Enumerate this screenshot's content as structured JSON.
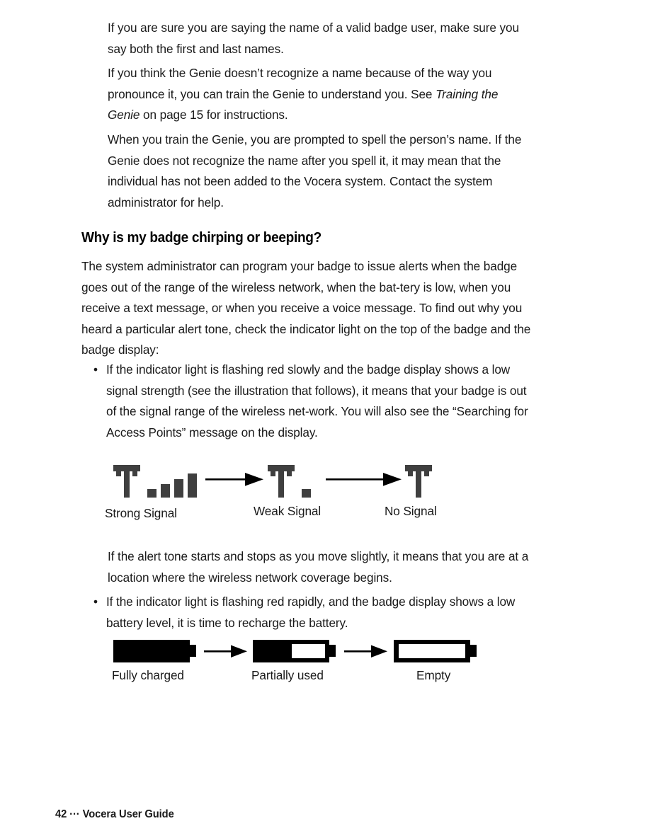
{
  "document": {
    "page_number": "42",
    "footer_separator": "···",
    "footer_title": "Vocera User Guide",
    "footer_full": "42 ··· Vocera User Guide"
  },
  "body": {
    "paragraph_1": "If you are sure you are saying the name of a valid badge user, make sure you say both the first and last names.",
    "paragraph_2_part1": "If you think the Genie doesn’t recognize a name because of the way you pronounce it, you can train the Genie to understand you. See ",
    "paragraph_2_italic": "Training the Genie",
    "paragraph_2_part2": " on page 15 for instructions.",
    "paragraph_3": "When you train the Genie, you are prompted to spell the person’s name. If the Genie does not recognize the name after you spell it, it may mean that the individual has not been added to the Vocera system. Contact the system administrator for help.",
    "heading": "Why is my badge chirping or beeping?",
    "paragraph_4": "The system administrator can program your badge to issue alerts when the badge goes out of the range of the wireless network, when the bat-tery is low, when you receive a text message, or when you receive a voice message. To find out why you heard a particular alert tone, check the indicator light on the top of the badge and the badge display:",
    "bullet_marker": "•",
    "bullet_1": "If the indicator light is flashing red slowly and the badge display shows a low signal strength (see the illustration that follows), it means that your badge is out of the signal range of the wireless net-work. You will also see the “Searching for Access Points” message on the display.",
    "paragraph_5": "If the alert tone starts and stops as you move slightly, it means that you are at a location where the wireless network coverage begins.",
    "bullet_2": "If the indicator light is flashing red rapidly, and the badge display shows a low battery level, it is time to recharge the battery."
  },
  "figures": {
    "signal": {
      "items": [
        {
          "label": "Strong Signal",
          "bars": 4
        },
        {
          "label": "Weak Signal",
          "bars": 1
        },
        {
          "label": "No Signal",
          "bars": 0
        }
      ],
      "icon_color": "#3f3f3f"
    },
    "battery": {
      "items": [
        {
          "label": "Fully charged",
          "fill": 100
        },
        {
          "label": "Partially used",
          "fill": 55
        },
        {
          "label": "Empty",
          "fill": 0
        }
      ],
      "icon_color": "#000000"
    }
  }
}
